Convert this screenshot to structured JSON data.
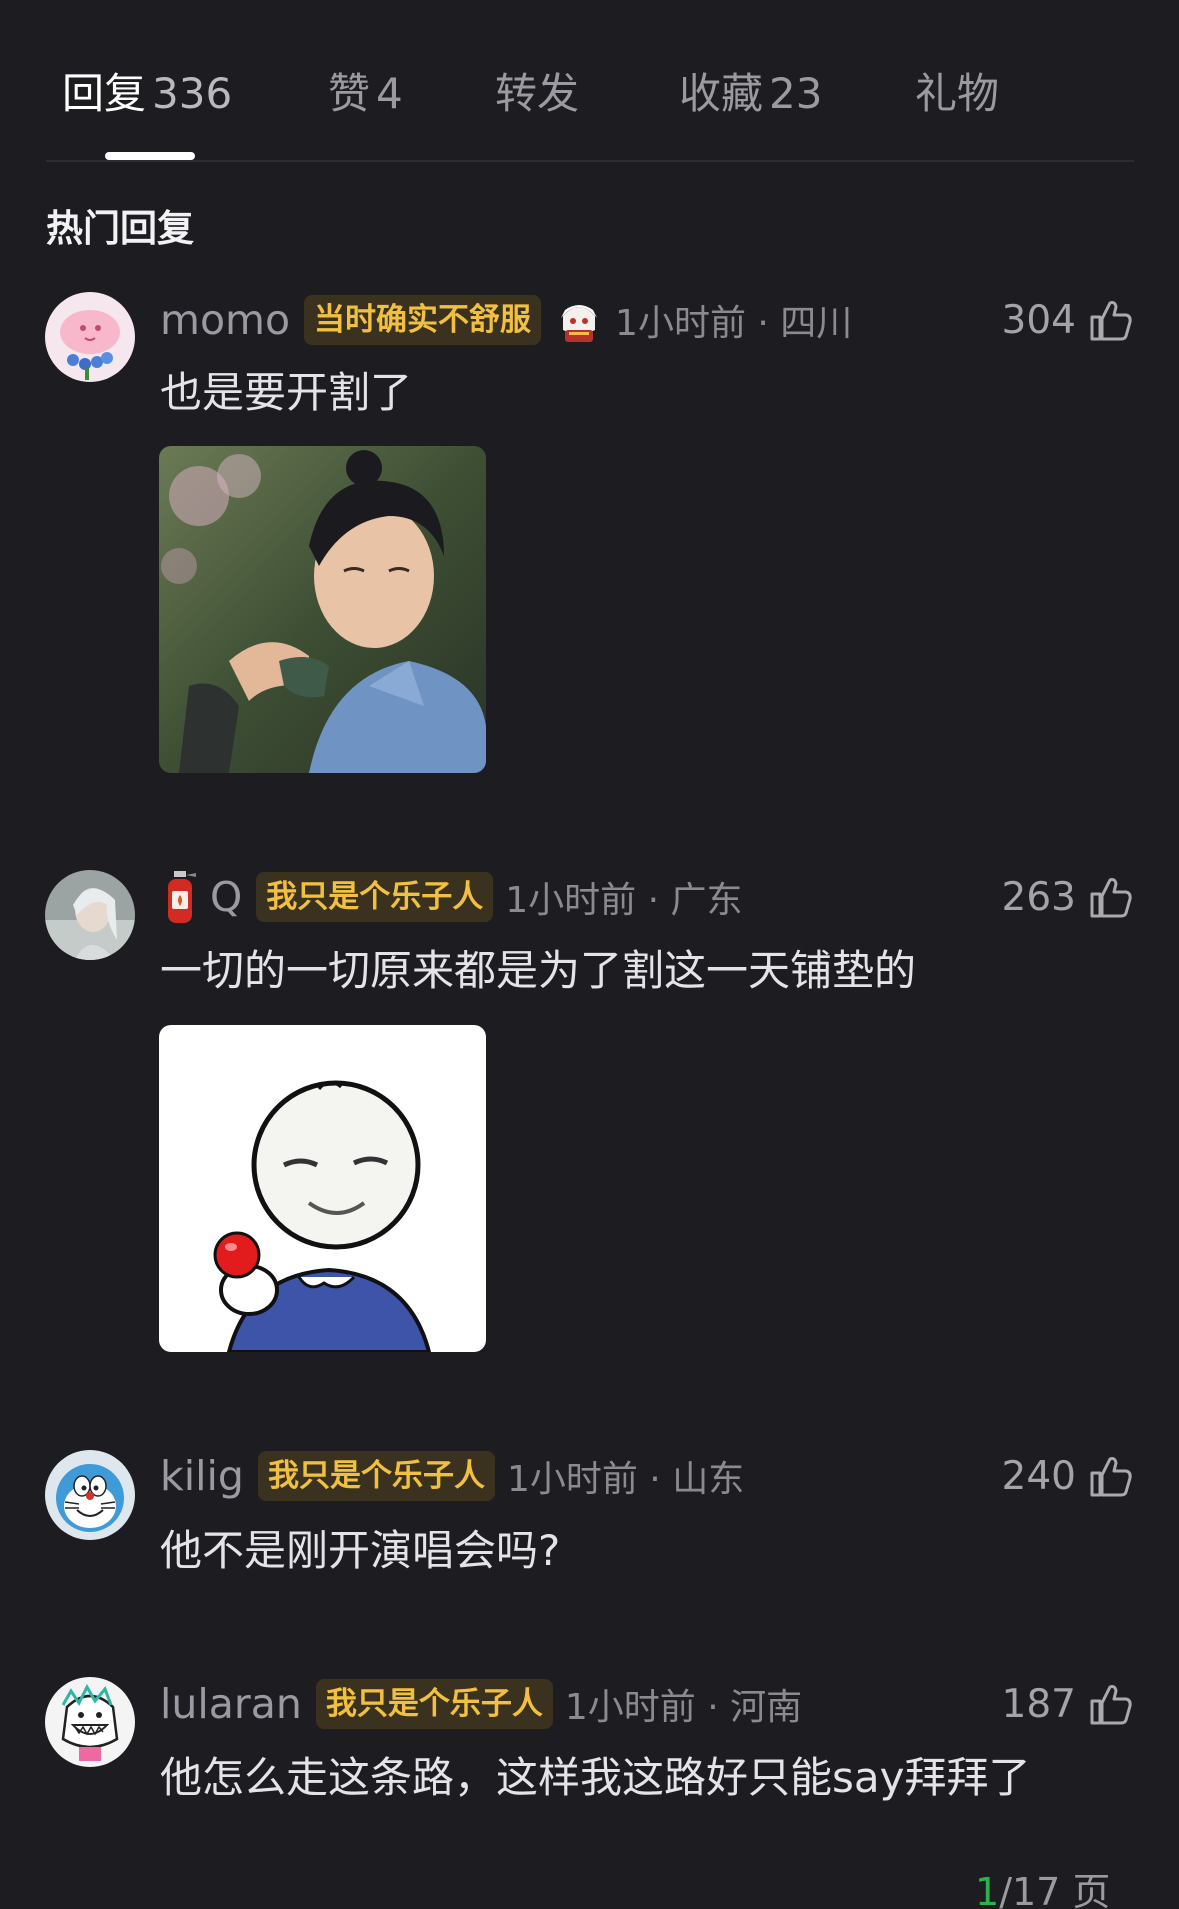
{
  "tabs": [
    {
      "label": "回复",
      "count": "336"
    },
    {
      "label": "赞",
      "count": "4"
    },
    {
      "label": "转发",
      "count": ""
    },
    {
      "label": "收藏",
      "count": "23"
    },
    {
      "label": "礼物",
      "count": ""
    }
  ],
  "section_title": "热门回复",
  "comments": [
    {
      "username": "momo",
      "badge": "当时确实不舒服",
      "time": "1小时前 · 四川",
      "likes": "304",
      "text": "也是要开割了",
      "image": "photo"
    },
    {
      "username": "Q",
      "badge": "我只是个乐子人",
      "time": "1小时前 · 广东",
      "likes": "263",
      "text": "一切的一切原来都是为了割这一天铺垫的",
      "image": "sticker"
    },
    {
      "username": "kilig",
      "badge": "我只是个乐子人",
      "time": "1小时前 · 山东",
      "likes": "240",
      "text": "他不是刚开演唱会吗?"
    },
    {
      "username": "lularan",
      "badge": "我只是个乐子人",
      "time": "1小时前 · 河南",
      "likes": "187",
      "text": "他怎么走这条路，这样我这路好只能say拜拜了"
    }
  ],
  "pager": {
    "current": "1",
    "total": "/17 页"
  },
  "icons": {
    "like": "thumbs-up-icon",
    "extinguisher": "fire-extinguisher-icon",
    "mascot": "mascot-sticker-icon"
  },
  "colors": {
    "background": "#1d1d21",
    "badge_text": "#f1c040",
    "badge_bg": "#3a321f",
    "pager_current": "#27b44f"
  }
}
